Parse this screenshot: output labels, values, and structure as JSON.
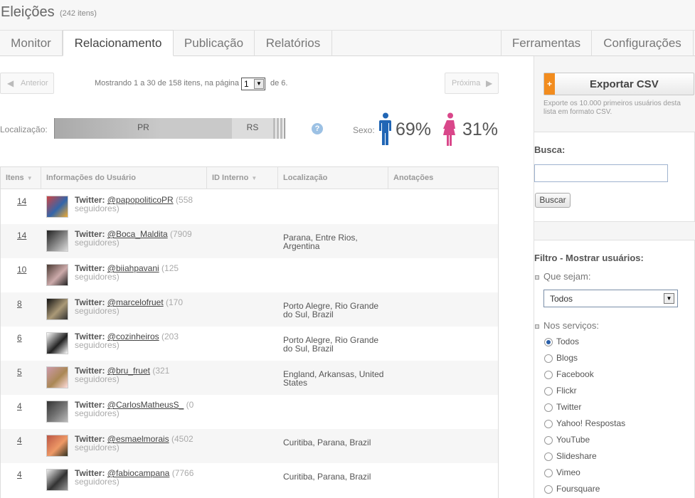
{
  "header": {
    "title": "Eleições",
    "count": "(242 itens)"
  },
  "tabs": [
    {
      "label": "Monitor"
    },
    {
      "label": "Relacionamento"
    },
    {
      "label": "Publicação"
    },
    {
      "label": "Relatórios"
    },
    {
      "label": "Ferramentas"
    },
    {
      "label": "Configurações"
    }
  ],
  "pager": {
    "prev": "Anterior",
    "info": "Mostrando 1 a 30 de 158 itens, na página",
    "page": "1",
    "of": "de 6.",
    "next": "Próxima"
  },
  "location": {
    "label": "Localização:",
    "segments": [
      {
        "name": "PR",
        "share": 0.77,
        "color": "#c9c9c9"
      },
      {
        "name": "RS",
        "share": 0.18,
        "color": "#dcdcdc"
      }
    ],
    "help_icon": "help-icon"
  },
  "sex": {
    "label": "Sexo:",
    "male_pct": "69%",
    "female_pct": "31%",
    "male_color": "#2166b5",
    "female_color": "#d9478a"
  },
  "table": {
    "headers": [
      "Itens",
      "Informações do Usuário",
      "ID Interno",
      "Localização",
      "Anotações"
    ],
    "rows": [
      {
        "items": "14",
        "handle": "@papopoliticoPR",
        "followers": "(558",
        "followers_word": "seguidores)",
        "location": ""
      },
      {
        "items": "14",
        "handle": "@Boca_Maldita",
        "followers": "(7909",
        "followers_word": "seguidores)",
        "location": "Parana, Entre Rios, Argentina"
      },
      {
        "items": "10",
        "handle": "@biiahpavani",
        "followers": "(125",
        "followers_word": "seguidores)",
        "location": ""
      },
      {
        "items": "8",
        "handle": "@marcelofruet",
        "followers": "(170",
        "followers_word": "seguidores)",
        "location": "Porto Alegre, Rio Grande do Sul, Brazil"
      },
      {
        "items": "6",
        "handle": "@cozinheiros",
        "followers": "(203",
        "followers_word": "seguidores)",
        "location": "Porto Alegre, Rio Grande do Sul, Brazil"
      },
      {
        "items": "5",
        "handle": "@bru_fruet",
        "followers": "(321",
        "followers_word": "seguidores)",
        "location": "England, Arkansas, United States"
      },
      {
        "items": "4",
        "handle": "@CarlosMatheusS_",
        "followers": "(0",
        "followers_word": "seguidores)",
        "location": ""
      },
      {
        "items": "4",
        "handle": "@esmaelmorais",
        "followers": "(4502",
        "followers_word": "seguidores)",
        "location": "Curitiba, Parana, Brazil"
      },
      {
        "items": "4",
        "handle": "@fabiocampana",
        "followers": "(7766",
        "followers_word": "seguidores)",
        "location": "Curitiba, Parana, Brazil"
      }
    ],
    "service_prefix": "Twitter: "
  },
  "sidebar": {
    "export_label": "Exportar CSV",
    "export_plus": "+",
    "export_desc": "Exporte os 10.000 primeiros usuários desta lista em formato CSV.",
    "search_title": "Busca:",
    "search_button": "Buscar",
    "filter_title": "Filtro - Mostrar usuários:",
    "filter_que_label": "Que sejam:",
    "filter_que_value": "Todos",
    "filter_services_label": "Nos serviços:",
    "services": [
      "Todos",
      "Blogs",
      "Facebook",
      "Flickr",
      "Twitter",
      "Yahoo! Respostas",
      "YouTube",
      "Slideshare",
      "Vimeo",
      "Foursquare"
    ],
    "services_selected": "Todos"
  }
}
